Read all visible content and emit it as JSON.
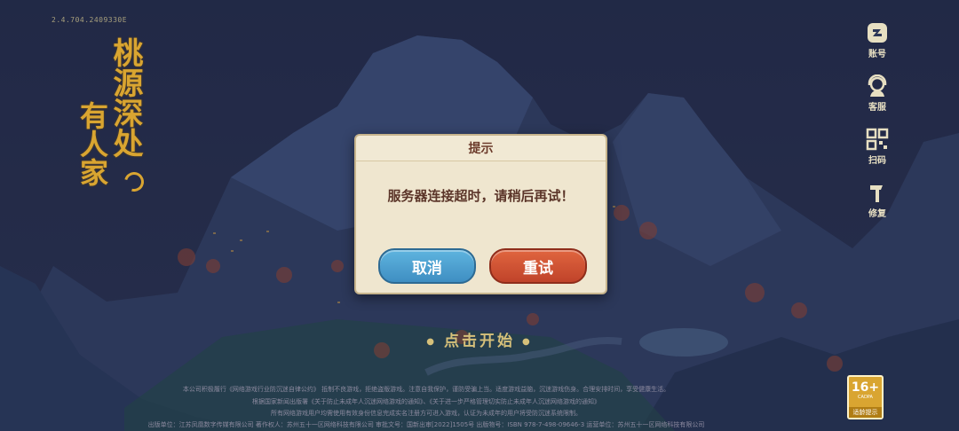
{
  "app": {
    "version": "2.4.704.2409330E",
    "logo_text_col1": "桃源深处",
    "logo_text_col2": "有人家"
  },
  "side_menu": {
    "items": [
      {
        "label": "账号",
        "icon": "account-icon"
      },
      {
        "label": "客服",
        "icon": "customer-service-icon"
      },
      {
        "label": "扫码",
        "icon": "qr-scan-icon"
      },
      {
        "label": "修复",
        "icon": "repair-hammer-icon"
      }
    ]
  },
  "dialog": {
    "title": "提示",
    "message": "服务器连接超时，请稍后再试！",
    "cancel_label": "取消",
    "retry_label": "重试"
  },
  "start": {
    "label": "点击开始"
  },
  "footer": {
    "line1": "本公司积极履行《网络游戏行业防沉迷自律公约》 抵制不良游戏，拒绝盗版游戏。注意自我保护，谨防受骗上当。适度游戏益脑，沉迷游戏伤身。合理安排时间，享受健康生活。",
    "line2": "根据国家新闻出版署《关于防止未成年人沉迷网络游戏的通知》、《关于进一步严格管理切实防止未成年人沉迷网络游戏的通知》",
    "line3": "所有网络游戏用户均需使用有效身份信息完成实名注册方可进入游戏，认证为未成年的用户将受防沉迷系统限制。",
    "line4": "出版单位：江苏凤凰数字传媒有限公司   著作权人：苏州五十一区网络科技有限公司   审批文号：国新出审[2022]1505号   出版物号：ISBN 978-7-498-09646-3   运营单位：苏州五十一区网络科技有限公司"
  },
  "age_rating": {
    "age": "16+",
    "org": "CADPA",
    "tip": "适龄提示"
  },
  "colors": {
    "accent_gold": "#d9a531",
    "cancel_blue": "#4a9fd0",
    "retry_red": "#d05434",
    "dialog_bg": "#efe6cf"
  }
}
